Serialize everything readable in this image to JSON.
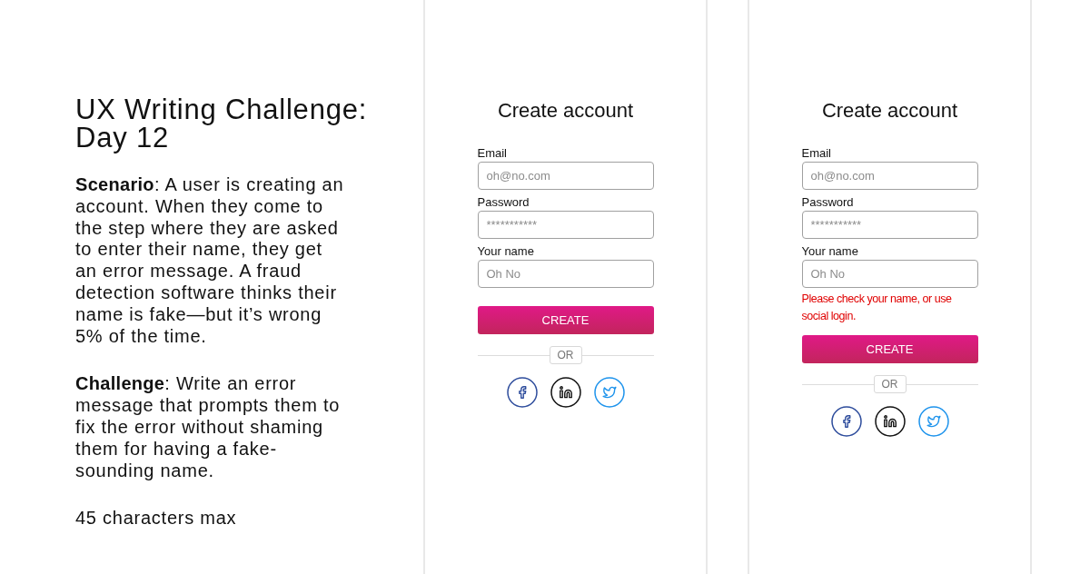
{
  "intro": {
    "title": "UX Writing Challenge: Day 12",
    "paragraphs": [
      "**Scenario**: A user is creating an account. When they come to the step where they are asked to enter their name, they get an error message. A fraud detection software thinks their name is fake—but it’s wrong 5% of the time.",
      "**Challenge**: Write an error message that prompts them to fix the error without shaming them for having a fake-sounding name."
    ],
    "note": "45 characters max"
  },
  "screens": [
    {
      "title": "Create account",
      "fields": [
        {
          "label": "Email",
          "placeholder": "oh@no.com"
        },
        {
          "label": "Password",
          "placeholder": "***********"
        },
        {
          "label": "Your name",
          "placeholder": "Oh No"
        }
      ],
      "button": "CREATE",
      "divider": "OR"
    },
    {
      "title": "Create account",
      "fields": [
        {
          "label": "Email",
          "placeholder": "oh@no.com"
        },
        {
          "label": "Password",
          "placeholder": "***********"
        },
        {
          "label": "Your name",
          "placeholder": "Oh No"
        }
      ],
      "error": "Please check your name, or use social login.",
      "button": "CREATE",
      "divider": "OR"
    }
  ]
}
